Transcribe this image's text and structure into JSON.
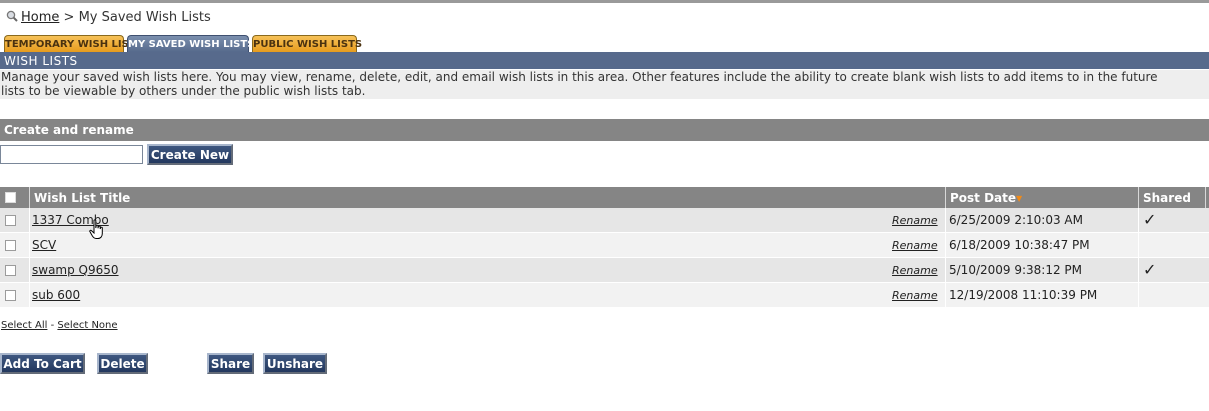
{
  "breadcrumb": {
    "icon": "magnifier-icon",
    "home": "Home",
    "separator": ">",
    "current": "My Saved Wish Lists"
  },
  "tabs": [
    {
      "label": "TEMPORARY WISH LIST",
      "active": false
    },
    {
      "label": "MY SAVED WISH LISTS",
      "active": true
    },
    {
      "label": "PUBLIC WISH LISTS",
      "active": false
    }
  ],
  "section": {
    "title": "WISH LISTS",
    "description_line1": "Manage your saved wish lists here. You may view, rename, delete, edit, and email wish lists in this area. Other features include the ability to create blank wish lists to add items to in the future",
    "description_line2": "lists to be viewable by others under the public wish lists tab."
  },
  "create": {
    "header": "Create and rename",
    "input_value": "",
    "button": "Create New"
  },
  "table": {
    "columns": {
      "title": "Wish List Title",
      "post_date": "Post Date",
      "shared": "Shared"
    },
    "rename_label": "Rename",
    "rows": [
      {
        "title": "1337 Combo",
        "date": "6/25/2009 2:10:03 AM",
        "shared": true
      },
      {
        "title": "SCV",
        "date": "6/18/2009 10:38:47 PM",
        "shared": false
      },
      {
        "title": "swamp Q9650",
        "date": "5/10/2009 9:38:12 PM",
        "shared": true
      },
      {
        "title": "sub 600",
        "date": "12/19/2008 11:10:39 PM",
        "shared": false
      }
    ]
  },
  "selectors": {
    "select_all": "Select All",
    "dash": "-",
    "select_none": "Select None"
  },
  "actions": {
    "add_to_cart": "Add To Cart",
    "delete": "Delete",
    "share": "Share",
    "unshare": "Unshare"
  },
  "colors": {
    "header_blue": "#576a8c",
    "tab_orange": "#e79c1e",
    "grey_bar": "#858585",
    "button_navy": "#23385e"
  }
}
